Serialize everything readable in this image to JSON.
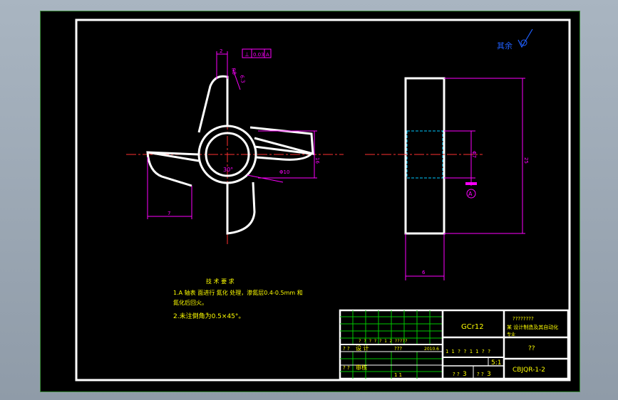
{
  "drawing": {
    "corner_mark": "其余",
    "tolerance_frame": {
      "symbol": "⊥",
      "value": "0.03",
      "datum": "A"
    },
    "datum_label": "A",
    "dims": {
      "top": "2",
      "angle": "R8",
      "roughness": "6.3",
      "ring": "30°",
      "hole_dia": "Φ10",
      "height_right": "16",
      "left_width": "7",
      "side_height": "25",
      "side_inner": "Φ7",
      "side_width": "6"
    },
    "notes": {
      "title": "技 术 要 求",
      "line1": "1.A 轴表 面进行 氮化 处理，渗氮层0.4-0.5mm 和",
      "line2": "氮化后回火。",
      "line3": "2.未注倒角为0.5×45°。"
    },
    "title_block": {
      "material": "GCr12",
      "company": "????????",
      "project": "某 设计制造及其自动化",
      "project2": "专业",
      "part_name": "??",
      "scale": "5:1",
      "sheet_left": "3",
      "sheet_right": "3",
      "drawing_no": "CBJQR-1-2",
      "row_a": "? ? ?   ? ?   1   2 ?????",
      "row_b_left": "? ?",
      "row_b_name": "设 计",
      "row_b_mid": "???",
      "row_b_date": "2010.6",
      "row_c_left": "? ?",
      "row_c_name": "审核",
      "row_c_num": "1 1",
      "row_mid_labels": "1 1 ? ?   1 1   ? ?",
      "row_sheet_label_l": "? ?",
      "row_sheet_label_r": "? ?"
    }
  }
}
